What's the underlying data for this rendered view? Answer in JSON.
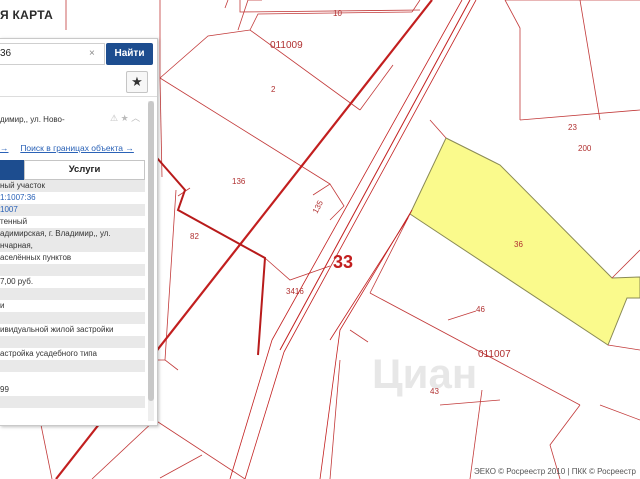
{
  "app": {
    "title": "Я КАРТА"
  },
  "search": {
    "value": "36",
    "clear_icon": "×",
    "button_label": "Найти"
  },
  "panel": {
    "fav_icon": "★",
    "tools_icons": "⚠ ★ ︿",
    "address": "димир,, ул. Ново-",
    "link_left": "→",
    "link_search": "Поиск в границах объекта →",
    "tab_services": "Услуги",
    "rows": [
      {
        "text": "ный участок",
        "style": "shade"
      },
      {
        "text": "1:1007:36",
        "style": "link"
      },
      {
        "text": "1007",
        "style": "link-shade"
      },
      {
        "text": "тенный",
        "style": "plain"
      },
      {
        "text": "адимирская, г. Владимир,, ул.",
        "style": "shade"
      },
      {
        "text": "нчарная,",
        "style": "shade"
      },
      {
        "text": "аселённых пунктов",
        "style": "plain"
      },
      {
        "text": "",
        "style": "shade"
      },
      {
        "text": "7,00 руб.",
        "style": "plain"
      },
      {
        "text": "",
        "style": "shade"
      },
      {
        "text": "и",
        "style": "plain"
      },
      {
        "text": "",
        "style": "shade"
      },
      {
        "text": "ивидуальной жилой застройки",
        "style": "plain"
      },
      {
        "text": "",
        "style": "shade"
      },
      {
        "text": "астройка усадебного типа",
        "style": "plain"
      },
      {
        "text": "",
        "style": "shade"
      },
      {
        "text": "",
        "style": "plain"
      },
      {
        "text": "99",
        "style": "plain"
      },
      {
        "text": "",
        "style": "shade"
      }
    ]
  },
  "map": {
    "road_number": "33",
    "block_labels": [
      "011009",
      "011007"
    ],
    "parcel_labels": [
      "10",
      "2",
      "136",
      "135",
      "82",
      "3416",
      "23",
      "200",
      "36",
      "46",
      "43"
    ],
    "highlight_color": "#fafa8c",
    "boundary_color": "#c21f1f"
  },
  "watermark": "Циан",
  "attribution": "ЭЕКО © Росреестр 2010 | ПКК © Росреестр"
}
